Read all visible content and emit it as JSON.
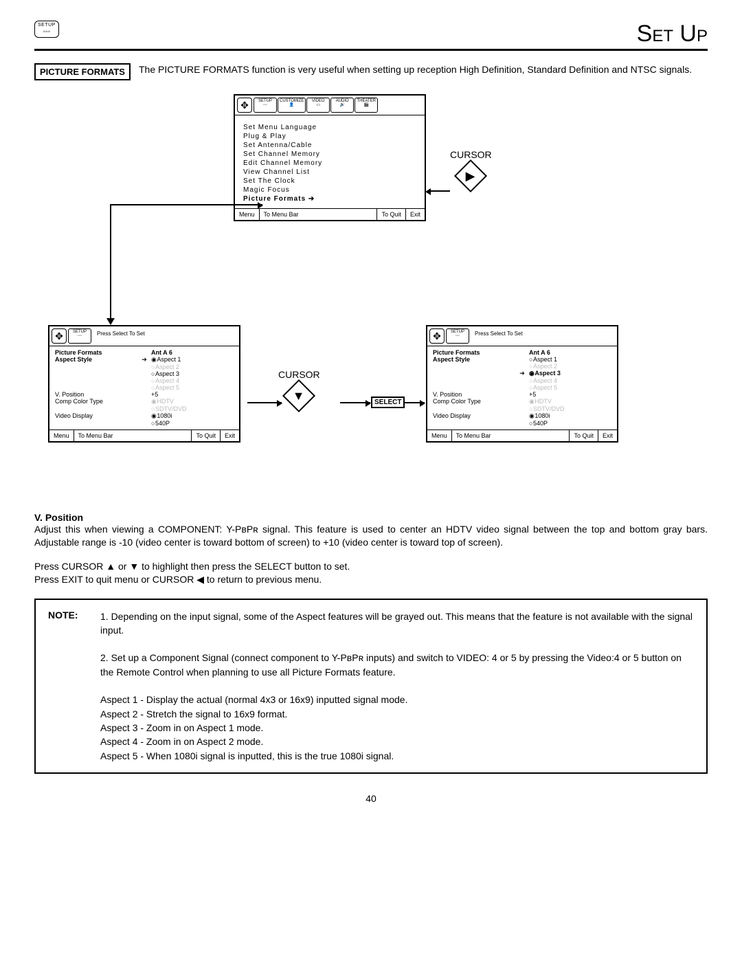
{
  "header": {
    "setup_icon_label": "SETUP",
    "title": "Set Up"
  },
  "intro": {
    "box_label": "PICTURE FORMATS",
    "text": "The PICTURE FORMATS function is very useful when setting up reception High Definition, Standard Definition and NTSC signals."
  },
  "osd_main": {
    "tabs": [
      "SETUP",
      "CUSTOMIZE",
      "VIDEO",
      "AUDIO",
      "THEATER"
    ],
    "items": [
      "Set Menu Language",
      "Plug & Play",
      "Set Antenna/Cable",
      "Set Channel Memory",
      "Edit Channel Memory",
      "View Channel List",
      "Set The Clock",
      "Magic Focus"
    ],
    "selected": "Picture Formats",
    "foot_menu": "Menu",
    "foot_bar": "To Menu Bar",
    "foot_quit": "To Quit",
    "foot_exit": "Exit"
  },
  "cursor_right_label": "CURSOR",
  "cursor_down_label": "CURSOR",
  "select_label": "SELECT",
  "osd_pf": {
    "press_select": "Press Select To Set",
    "title": "Picture Formats",
    "source": "Ant A 6",
    "aspect_label": "Aspect Style",
    "aspects": [
      "Aspect 1",
      "Aspect 2",
      "Aspect 3",
      "Aspect 4",
      "Aspect 5"
    ],
    "vpos_label": "V. Position",
    "vpos_value": "+5",
    "cct_label": "Comp Color Type",
    "cct_opts": [
      "HDTV",
      "SDTV/DVD"
    ],
    "vd_label": "Video Display",
    "vd_opts": [
      "1080i",
      "540P"
    ],
    "foot_menu": "Menu",
    "foot_bar": "To Menu Bar",
    "foot_quit": "To Quit",
    "foot_exit": "Exit"
  },
  "vpos": {
    "heading": "V. Position",
    "para": "Adjust this when viewing a COMPONENT: Y-PʙPʀ signal. This feature is used to center an HDTV video signal between the top and bottom gray bars. Adjustable range is -10 (video center is toward bottom of screen) to +10 (video center is toward top of screen).",
    "l1": "Press CURSOR ▲ or ▼ to highlight then press the SELECT button to set.",
    "l2": "Press EXIT to quit menu or CURSOR ◀ to return to previous menu."
  },
  "note": {
    "label": "NOTE:",
    "n1": "1. Depending on the input signal, some of the Aspect features will be grayed out. This means that the feature is not available with the signal input.",
    "n2": "2. Set up a Component Signal (connect component to Y-PʙPʀ inputs) and switch to VIDEO: 4 or 5 by pressing the Video:4 or 5 button on the Remote Control when planning to use all Picture Formats feature.",
    "a1": "Aspect 1 - Display the actual (normal 4x3 or 16x9) inputted signal mode.",
    "a2": "Aspect 2 - Stretch the signal to 16x9 format.",
    "a3": "Aspect 3 - Zoom in on Aspect 1 mode.",
    "a4": "Aspect 4 - Zoom in on Aspect 2 mode.",
    "a5": "Aspect 5 - When 1080i signal is inputted, this is the true 1080i signal."
  },
  "page_number": "40"
}
